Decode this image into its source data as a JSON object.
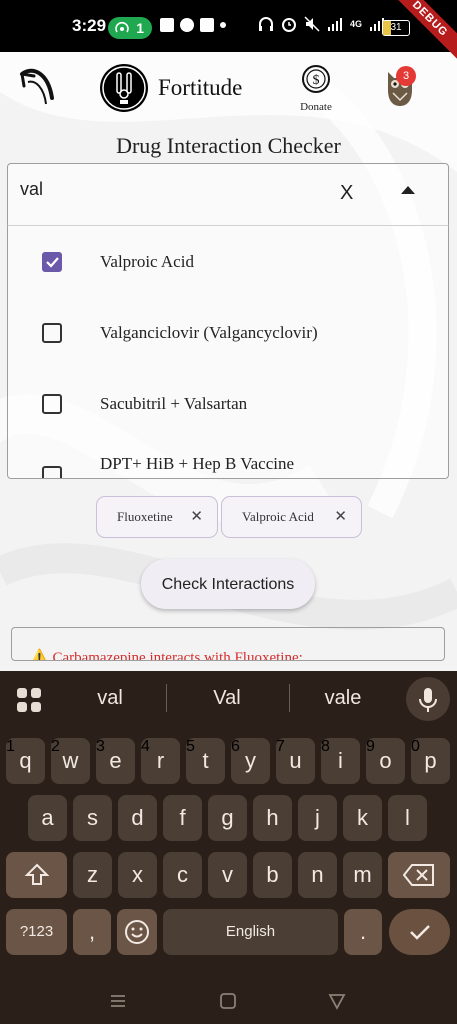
{
  "status_bar": {
    "time": "3:29",
    "hotspot_count": "1",
    "network": "4G",
    "battery": "31",
    "debug_label": "DEBUG"
  },
  "header": {
    "app_title": "Fortitude",
    "donate_label": "Donate",
    "notification_count": "3"
  },
  "page_title": "Drug Interaction Checker",
  "search": {
    "value": "val",
    "clear_label": "X"
  },
  "options": [
    {
      "label": "Valproic Acid",
      "checked": true
    },
    {
      "label": "Valganciclovir (Valgancyclovir)",
      "checked": false
    },
    {
      "label": "Sacubitril + Valsartan",
      "checked": false
    },
    {
      "label": "DPT+ HiB + Hep B Vaccine",
      "checked": false
    }
  ],
  "selected_chips": [
    {
      "label": "Fluoxetine",
      "remove": "✕"
    },
    {
      "label": "Valproic Acid",
      "remove": "✕"
    }
  ],
  "check_button": "Check Interactions",
  "result": {
    "warning_icon": "⚠️",
    "text": "Carbamazepine interacts with Fluoxetine:"
  },
  "keyboard": {
    "suggestions": [
      "val",
      "Val",
      "vale"
    ],
    "row1": [
      {
        "k": "q",
        "h": "1"
      },
      {
        "k": "w",
        "h": "2"
      },
      {
        "k": "e",
        "h": "3"
      },
      {
        "k": "r",
        "h": "4"
      },
      {
        "k": "t",
        "h": "5"
      },
      {
        "k": "y",
        "h": "6"
      },
      {
        "k": "u",
        "h": "7"
      },
      {
        "k": "i",
        "h": "8"
      },
      {
        "k": "o",
        "h": "9"
      },
      {
        "k": "p",
        "h": "0"
      }
    ],
    "row2": [
      "a",
      "s",
      "d",
      "f",
      "g",
      "h",
      "j",
      "k",
      "l"
    ],
    "row3": [
      "z",
      "x",
      "c",
      "v",
      "b",
      "n",
      "m"
    ],
    "symbols_label": "?123",
    "comma": ",",
    "space_label": "English",
    "period": ".",
    "shift_icon": "shift-icon",
    "backspace_icon": "backspace-icon",
    "done_icon": "check-icon"
  },
  "colors": {
    "accent": "#6a58a8",
    "warning_text": "#d32f2f",
    "keyboard_bg": "#2a2019",
    "badge": "#e53935"
  }
}
